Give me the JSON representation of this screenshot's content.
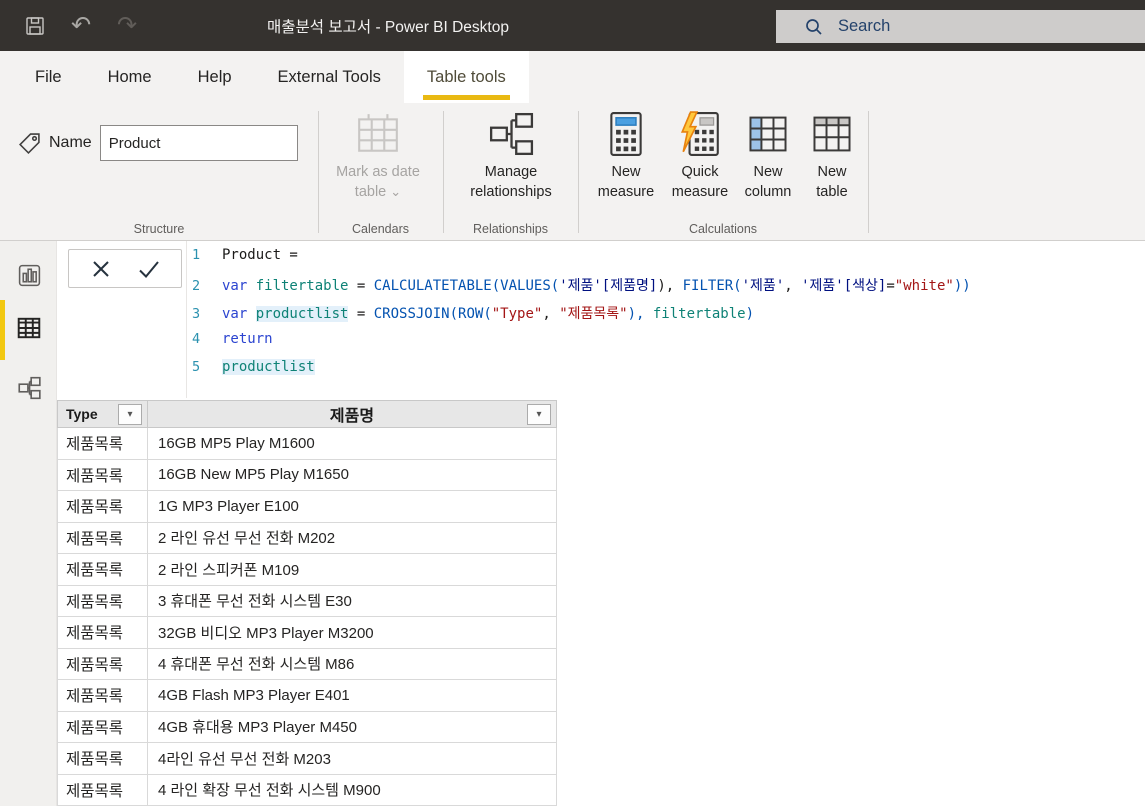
{
  "titlebar": {
    "title": "매출분석 보고서 - Power BI Desktop",
    "search_placeholder": "Search"
  },
  "ribbon": {
    "tabs": [
      {
        "label": "File",
        "active": false
      },
      {
        "label": "Home",
        "active": false
      },
      {
        "label": "Help",
        "active": false
      },
      {
        "label": "External Tools",
        "active": false
      },
      {
        "label": "Table tools",
        "active": true
      }
    ],
    "structure": {
      "group_label": "Structure",
      "name_label": "Name",
      "name_value": "Product"
    },
    "calendars": {
      "group_label": "Calendars",
      "mark_as_date_table_label": "Mark as date table",
      "chevron": "⌄"
    },
    "relationships": {
      "group_label": "Relationships",
      "manage_label": "Manage relationships"
    },
    "calculations": {
      "group_label": "Calculations",
      "new_measure": "New measure",
      "quick_measure": "Quick measure",
      "new_column": "New column",
      "new_table": "New table"
    }
  },
  "view_sidebar": {
    "items": [
      {
        "name": "report-view",
        "icon": "bar-chart-icon",
        "active": false
      },
      {
        "name": "data-view",
        "icon": "table-grid-icon",
        "active": true
      },
      {
        "name": "model-view",
        "icon": "model-diagram-icon",
        "active": false
      }
    ]
  },
  "formula_bar": {
    "cancel_icon": "x-icon",
    "commit_icon": "check-icon",
    "lines": [
      {
        "num": "1",
        "segments": [
          {
            "c": "p",
            "t": "Product ="
          }
        ]
      },
      {
        "num": "2",
        "segments": [
          {
            "c": "k",
            "t": "var "
          },
          {
            "c": "v",
            "t": "filtertable"
          },
          {
            "c": "p",
            "t": " = "
          },
          {
            "c": "f",
            "t": "CALCULATETABLE("
          },
          {
            "c": "f",
            "t": "VALUES("
          },
          {
            "c": "r",
            "t": "'제품'[제품명]"
          },
          {
            "c": "p",
            "t": "), "
          },
          {
            "c": "f",
            "t": "FILTER("
          },
          {
            "c": "r",
            "t": "'제품'"
          },
          {
            "c": "p",
            "t": ", "
          },
          {
            "c": "r",
            "t": "'제품'[색상]"
          },
          {
            "c": "p",
            "t": "="
          },
          {
            "c": "s",
            "t": "\"white\""
          },
          {
            "c": "f",
            "t": "))"
          }
        ]
      },
      {
        "num": "3",
        "segments": [
          {
            "c": "k",
            "t": "var "
          },
          {
            "c": "vh",
            "t": "productlist"
          },
          {
            "c": "p",
            "t": " = "
          },
          {
            "c": "f",
            "t": "CROSSJOIN("
          },
          {
            "c": "f",
            "t": "ROW("
          },
          {
            "c": "s",
            "t": "\"Type\""
          },
          {
            "c": "p",
            "t": ", "
          },
          {
            "c": "s",
            "t": "\"제품목록\""
          },
          {
            "c": "f",
            "t": "), "
          },
          {
            "c": "v",
            "t": "filtertable"
          },
          {
            "c": "f",
            "t": ")"
          }
        ]
      },
      {
        "num": "4",
        "segments": [
          {
            "c": "k",
            "t": "return"
          }
        ]
      },
      {
        "num": "5",
        "segments": [
          {
            "c": "vh",
            "t": "productlist"
          }
        ]
      }
    ]
  },
  "table": {
    "columns": [
      {
        "label": "Type"
      },
      {
        "label": "제품명"
      }
    ],
    "rows": [
      {
        "type": "제품목록",
        "name": "16GB MP5 Play M1600"
      },
      {
        "type": "제품목록",
        "name": "16GB New MP5 Play M1650"
      },
      {
        "type": "제품목록",
        "name": "1G MP3 Player E100"
      },
      {
        "type": "제품목록",
        "name": "2 라인 유선 무선 전화 M202"
      },
      {
        "type": "제품목록",
        "name": "2 라인 스피커폰 M109"
      },
      {
        "type": "제품목록",
        "name": "3 휴대폰 무선 전화 시스템 E30"
      },
      {
        "type": "제품목록",
        "name": "32GB 비디오 MP3 Player M3200"
      },
      {
        "type": "제품목록",
        "name": "4 휴대폰 무선 전화 시스템 M86"
      },
      {
        "type": "제품목록",
        "name": "4GB Flash MP3 Player E401"
      },
      {
        "type": "제품목록",
        "name": "4GB 휴대용 MP3 Player M450"
      },
      {
        "type": "제품목록",
        "name": "4라인 유선 무선 전화 M203"
      },
      {
        "type": "제품목록",
        "name": "4 라인 확장 무선 전화 시스템 M900"
      }
    ]
  },
  "colors": {
    "accent_yellow": "#F2C811",
    "tab_underline": "#E9B912",
    "titlebar_bg": "#35322F",
    "ribbon_bg": "#F3F2F1",
    "syntax_keyword": "#2B44D0",
    "syntax_function": "#0352B0",
    "syntax_variable": "#0E8276",
    "syntax_reference": "#001080",
    "syntax_string": "#A31515",
    "line_number": "#2B91AF",
    "variable_highlight_bg": "#E3F0FA",
    "table_header_bg": "#E7E7E7"
  }
}
